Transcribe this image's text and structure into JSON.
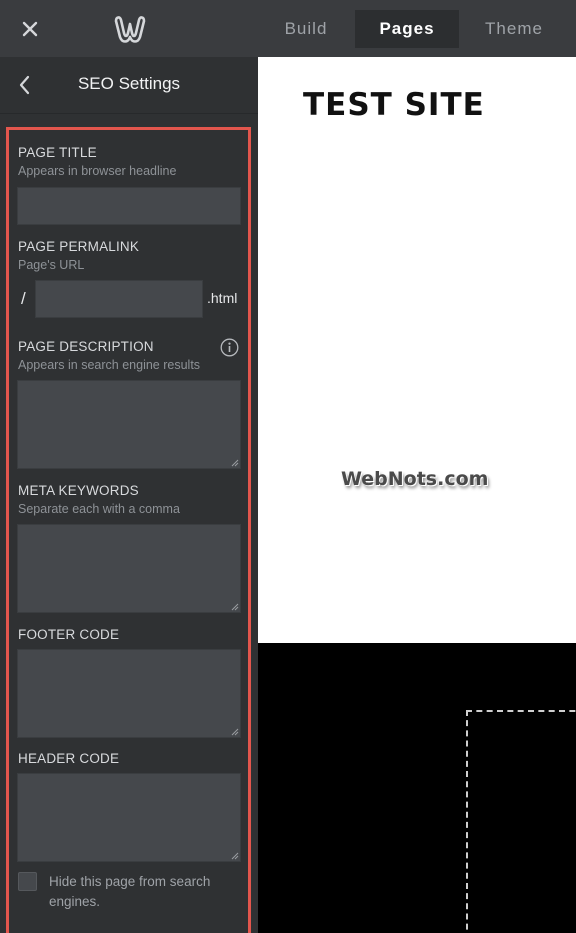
{
  "topbar": {
    "close_icon": "close-icon",
    "logo_icon": "weebly-logo-icon",
    "tabs": [
      {
        "label": "Build",
        "active": false
      },
      {
        "label": "Pages",
        "active": true
      },
      {
        "label": "Theme",
        "active": false
      }
    ]
  },
  "panel": {
    "back_icon": "chevron-left-icon",
    "title": "SEO Settings",
    "fields": {
      "page_title": {
        "label": "PAGE TITLE",
        "hint": "Appears in browser headline",
        "value": ""
      },
      "permalink": {
        "label": "PAGE PERMALINK",
        "hint": "Page's URL",
        "prefix": "/",
        "suffix": ".html",
        "value": ""
      },
      "description": {
        "label": "PAGE DESCRIPTION",
        "hint": "Appears in search engine results",
        "value": "",
        "info_icon": "info-icon"
      },
      "keywords": {
        "label": "META KEYWORDS",
        "hint": "Separate each with a comma",
        "value": ""
      },
      "footer_code": {
        "label": "FOOTER CODE",
        "value": ""
      },
      "header_code": {
        "label": "HEADER CODE",
        "value": ""
      }
    },
    "hide_checkbox": {
      "label": "Hide this page from search engines.",
      "checked": false
    }
  },
  "preview": {
    "site_title": "TEST SITE",
    "watermark": "WebNots.com"
  },
  "colors": {
    "topbar_bg": "#3a3c3f",
    "panel_bg": "#2f3133",
    "field_bg": "#45484c",
    "highlight": "#e3564d"
  }
}
